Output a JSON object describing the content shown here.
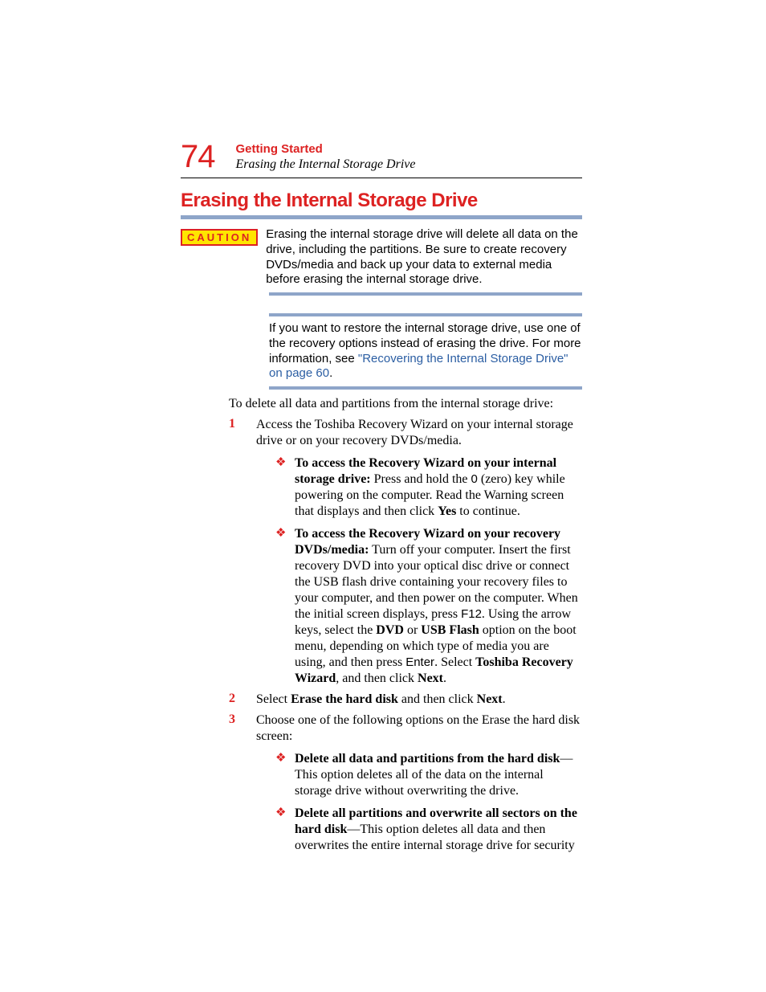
{
  "page": {
    "number": "74",
    "chapter": "Getting Started",
    "subchapter": "Erasing the Internal Storage Drive",
    "section_title": "Erasing the Internal Storage Drive"
  },
  "caution": {
    "badge": "CAUTION",
    "text": "Erasing the internal storage drive will delete all data on the drive, including the partitions. Be sure to create recovery DVDs/media and back up your data to external media before erasing the internal storage drive."
  },
  "note": {
    "pre": "If you want to restore the internal storage drive, use one of the recovery options instead of erasing the drive. For more information, see ",
    "link": "\"Recovering the Internal Storage Drive\" on page 60",
    "post": "."
  },
  "intro": "To delete all data and partitions from the internal storage drive:",
  "steps": {
    "s1": {
      "num": "1",
      "text": "Access the Toshiba Recovery Wizard on your internal storage drive or on your recovery DVDs/media.",
      "sub_a": {
        "lead_b": "To access the Recovery Wizard on your internal storage drive:",
        "t1": " Press and hold the ",
        "key1": "0",
        "t2": " (zero) key while powering on the computer. Read the Warning screen that displays and then click ",
        "b1": "Yes",
        "t3": " to continue."
      },
      "sub_b": {
        "lead_b": "To access the Recovery Wizard on your recovery DVDs/media:",
        "t1": " Turn off your computer. Insert the first recovery DVD into your optical disc drive or connect the USB flash drive containing your recovery files to your computer, and then power on the computer. When the initial screen displays, press ",
        "key1": "F12",
        "t2": ". Using the arrow keys, select the ",
        "b1": "DVD",
        "t3": " or ",
        "b2": "USB Flash",
        "t4": " option on the boot menu, depending on which type of media you are using, and then press ",
        "key2": "Enter",
        "t5": ". Select ",
        "b3": "Toshiba Recovery Wizard",
        "t6": ", and then click ",
        "b4": "Next",
        "t7": "."
      }
    },
    "s2": {
      "num": "2",
      "t1": "Select ",
      "b1": "Erase the hard disk",
      "t2": " and then click ",
      "b2": "Next",
      "t3": "."
    },
    "s3": {
      "num": "3",
      "text": "Choose one of the following options on the Erase the hard disk screen:",
      "sub_a": {
        "b1": "Delete all data and partitions from the hard disk",
        "t1": "—This option deletes all of the data on the internal storage drive without overwriting the drive."
      },
      "sub_b": {
        "b1": "Delete all partitions and overwrite all sectors on the hard disk",
        "t1": "—This option deletes all data and then overwrites the entire internal storage drive for security"
      }
    }
  }
}
